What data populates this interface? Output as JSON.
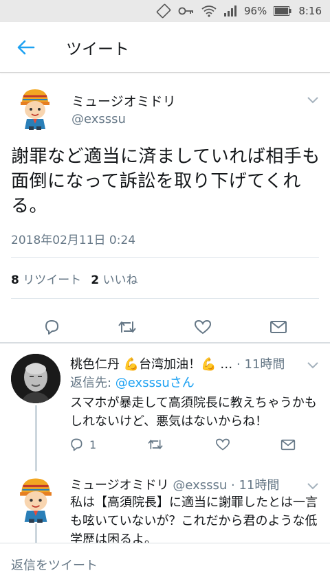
{
  "status_bar": {
    "battery": "96%",
    "time": "8:16"
  },
  "app_bar": {
    "title": "ツイート"
  },
  "main_tweet": {
    "name": "ミュージオミドリ",
    "handle": "@exsssu",
    "text": "謝罪など適当に済ましていれば相手も面倒になって訴訟を取り下げてくれる。",
    "timestamp": "2018年02月11日 0:24",
    "retweet_count": "8",
    "retweet_label": "リツイート",
    "like_count": "2",
    "like_label": "いいね"
  },
  "replies": [
    {
      "name": "桃色仁丹 💪台湾加油！💪 …",
      "meta": " · 11時間",
      "reply_to_label": "返信先: ",
      "reply_to_handle": "@exsssuさん",
      "text": "スマホが暴走して高須院長に教えちゃうかもしれないけど、悪気はないからね！",
      "reply_count": "1"
    },
    {
      "name": "ミュージオミドリ",
      "meta": " @exsssu · 11時間",
      "text": "私は【高須院長】に適当に謝罪したとは一言も呟いていないが？これだから君のような低学歴は困るよ。"
    }
  ],
  "reply_bar": {
    "placeholder": "返信をツイート"
  },
  "colors": {
    "accent": "#1da1f2",
    "muted": "#657786",
    "text": "#14171a"
  }
}
